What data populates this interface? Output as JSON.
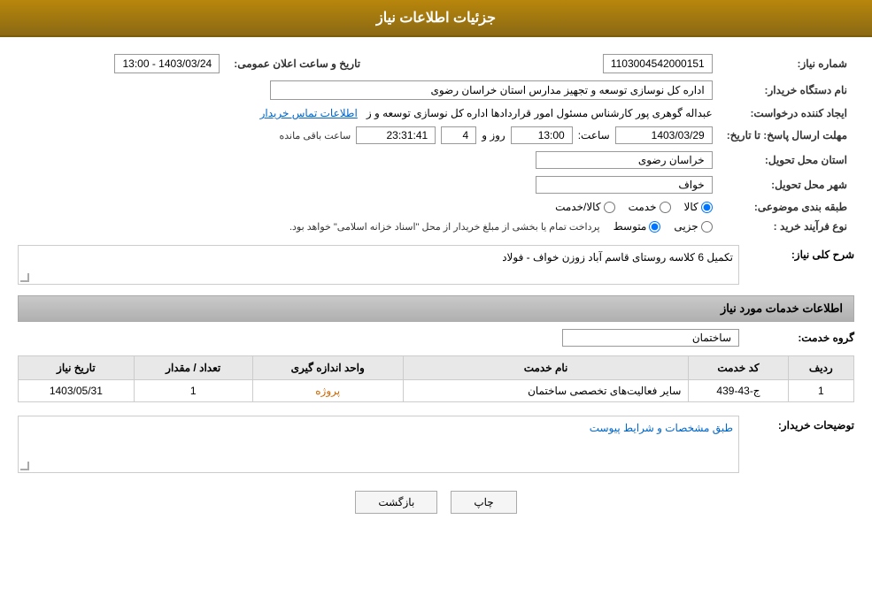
{
  "page": {
    "title": "جزئیات اطلاعات نیاز"
  },
  "header": {
    "announcement_label": "تاریخ و ساعت اعلان عمومی:",
    "announcement_value": "1403/03/24 - 13:00",
    "need_number_label": "شماره نیاز:",
    "need_number_value": "1103004542000151",
    "buyer_org_label": "نام دستگاه خریدار:",
    "buyer_org_value": "اداره کل نوسازی  توسعه و تجهیز مدارس استان خراسان رضوی",
    "creator_label": "ایجاد کننده درخواست:",
    "creator_value": "عبداله گوهری پور کارشناس مسئول امور قراردادها  اداره کل نوسازی  توسعه و ز",
    "contact_link": "اطلاعات تماس خریدار",
    "deadline_label": "مهلت ارسال پاسخ: تا تاریخ:",
    "deadline_date": "1403/03/29",
    "deadline_time_label": "ساعت:",
    "deadline_time": "13:00",
    "deadline_days_label": "روز و",
    "deadline_days": "4",
    "countdown_label": "ساعت باقی مانده",
    "countdown_value": "23:31:41",
    "province_label": "استان محل تحویل:",
    "province_value": "خراسان رضوی",
    "city_label": "شهر محل تحویل:",
    "city_value": "خواف",
    "category_label": "طبقه بندی موضوعی:",
    "category_options": [
      "کالا",
      "خدمت",
      "کالا/خدمت"
    ],
    "category_selected": "کالا",
    "process_label": "نوع فرآیند خرید :",
    "process_options": [
      "جزیی",
      "متوسط"
    ],
    "process_note": "پرداخت تمام یا بخشی از مبلغ خریدار از محل \"اسناد خزانه اسلامی\" خواهد بود.",
    "need_description_label": "شرح کلی نیاز:",
    "need_description_value": "تکمیل 6 کلاسه روستای قاسم آباد زوزن خواف - فولاد"
  },
  "services_section": {
    "title": "اطلاعات خدمات مورد نیاز",
    "group_label": "گروه خدمت:",
    "group_value": "ساختمان",
    "table": {
      "columns": [
        "ردیف",
        "کد خدمت",
        "نام خدمت",
        "واحد اندازه گیری",
        "تعداد / مقدار",
        "تاریخ نیاز"
      ],
      "rows": [
        {
          "row_num": "1",
          "service_code": "ج-43-439",
          "service_name": "سایر فعالیت‌های تخصصی ساختمان",
          "unit": "پروژه",
          "quantity": "1",
          "date": "1403/05/31"
        }
      ]
    }
  },
  "buyer_description": {
    "label": "توضیحات خریدار:",
    "value": "طبق مشخصات و شرایط پیوست"
  },
  "buttons": {
    "print_label": "چاپ",
    "back_label": "بازگشت"
  }
}
